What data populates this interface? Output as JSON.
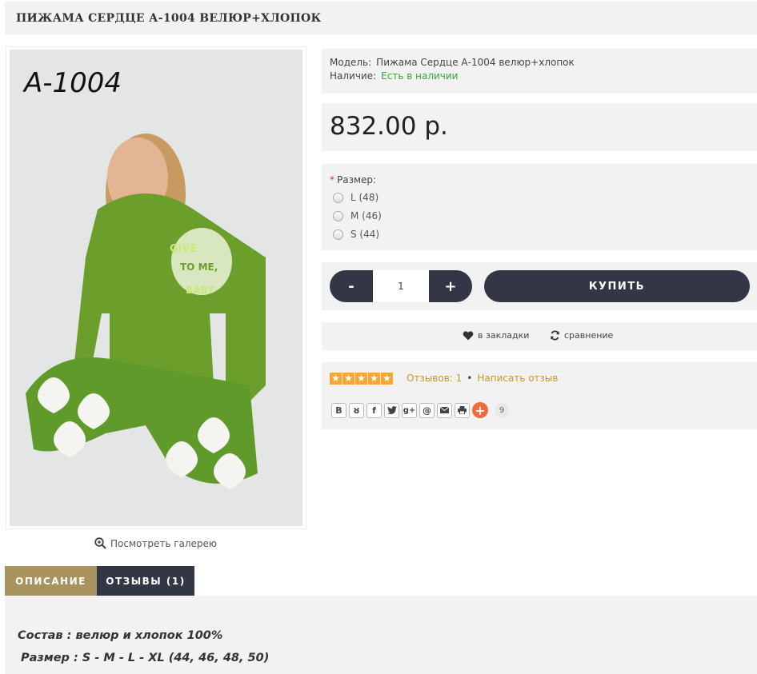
{
  "product": {
    "title": "ПИЖАМА СЕРДЦЕ А-1004 ВЕЛЮР+ХЛОПОК",
    "photo_code": "A-1004",
    "photo_print": [
      "GIVE",
      "TO ME,",
      "BABY"
    ],
    "gallery_link": "Посмотреть галерею"
  },
  "info": {
    "model_label": "Модель:",
    "model_value": "Пижама Сердце А-1004 велюр+хлопок",
    "stock_label": "Наличие:",
    "stock_value": "Есть в наличии"
  },
  "price": "832.00 р.",
  "size": {
    "label": "Размер:",
    "required_mark": "*",
    "options": [
      "L (48)",
      "M (46)",
      "S (44)"
    ]
  },
  "cart": {
    "minus": "-",
    "quantity": "1",
    "plus": "+",
    "buy_label": "КУПИТЬ"
  },
  "actions": {
    "wishlist": "в закладки",
    "compare": "сравнение"
  },
  "reviews": {
    "rating": 5,
    "count_text": "Отзывов: 1",
    "separator": "•",
    "write_text": "Написать отзыв"
  },
  "share": {
    "buttons": [
      "В",
      "ok",
      "f",
      "twitter",
      "g+",
      "@",
      "mail",
      "print"
    ],
    "count": "9"
  },
  "tabs": {
    "description": "ОПИСАНИЕ",
    "reviews": "ОТЗЫВЫ (1)"
  },
  "description": {
    "line1": "Состав : велюр и хлопок 100%",
    "line2": "Размер : S - M - L - XL (44, 46, 48, 50)"
  },
  "colors": {
    "dark": "#323645",
    "gold": "#a8935f",
    "stock_green": "#37a537",
    "star": "#f4a731",
    "link": "#c7972a"
  }
}
